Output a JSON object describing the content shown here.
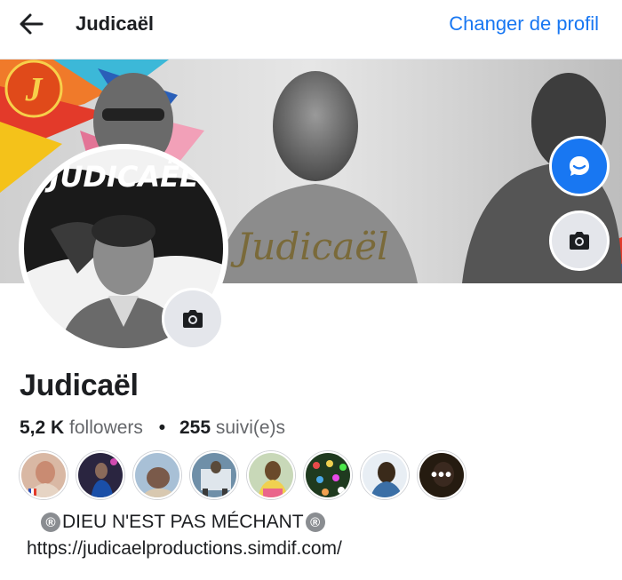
{
  "header": {
    "title": "Judicaël",
    "change_profile_label": "Changer de profil"
  },
  "cover": {
    "signature_text": "Judicaël",
    "logo_letter": "J",
    "avatar_banner_text": "JUDICAËL"
  },
  "profile": {
    "name": "Judicaël",
    "followers_count": "5,2 K",
    "followers_label": "followers",
    "separator": "•",
    "following_count": "255",
    "following_label": "suivi(e)s",
    "bio_mark": "®",
    "bio_text": "DIEU N'EST PAS MÉCHANT",
    "website": "https://judicaelproductions.simdif.com/"
  },
  "friends": {
    "more_label": "•••",
    "items": [
      {
        "icon": "friend-avatar",
        "color": "#c98b72"
      },
      {
        "icon": "friend-avatar",
        "color": "#2a2540"
      },
      {
        "icon": "friend-avatar",
        "color": "#a8c0d6"
      },
      {
        "icon": "friend-avatar",
        "color": "#6f8fa8"
      },
      {
        "icon": "friend-avatar",
        "color": "#b88a4a"
      },
      {
        "icon": "friend-avatar",
        "color": "#1f3a1f"
      },
      {
        "icon": "friend-avatar",
        "color": "#3b6fa6"
      },
      {
        "icon": "friend-avatar",
        "color": "#3a2a1a"
      }
    ]
  },
  "colors": {
    "accent": "#1877f2",
    "text": "#1c1e21",
    "muted": "#65676b",
    "button_gray": "#e4e6eb"
  },
  "icons": {
    "back": "arrow-left-icon",
    "messenger": "messenger-icon",
    "camera": "camera-icon",
    "more": "more-dots-icon"
  }
}
